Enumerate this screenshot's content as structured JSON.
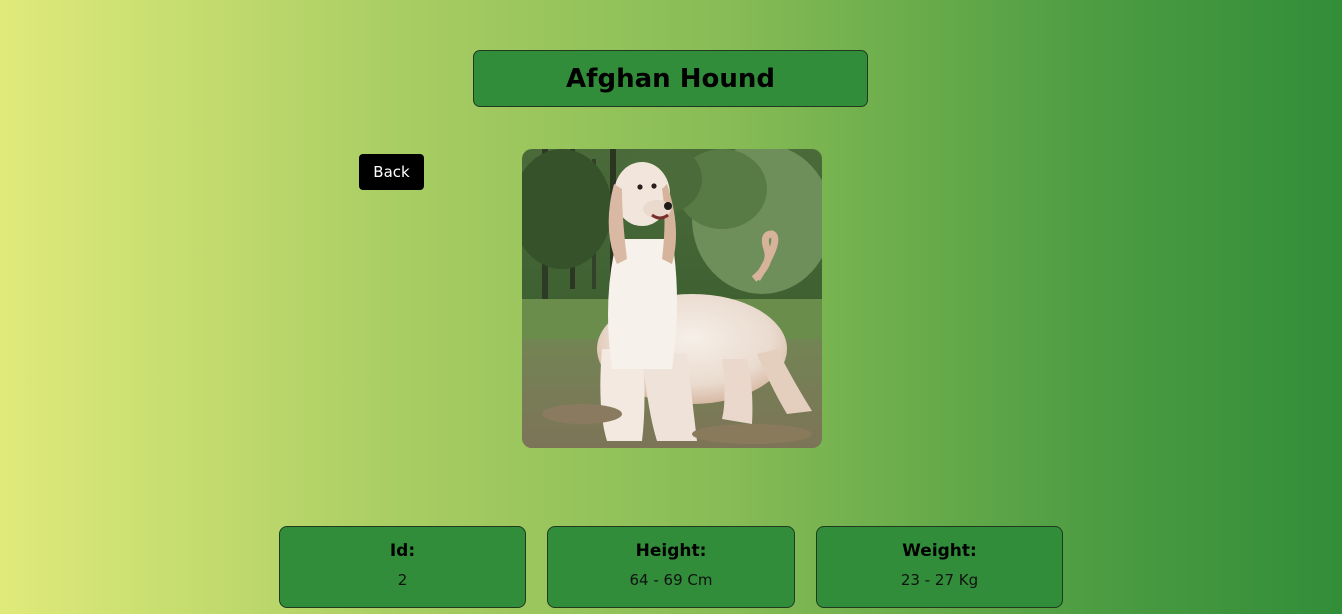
{
  "breed": {
    "name": "Afghan Hound"
  },
  "navigation": {
    "back_label": "Back"
  },
  "photo": {
    "subject": "afghan-hound-photo"
  },
  "stats": [
    {
      "label": "Id:",
      "value": "2"
    },
    {
      "label": "Height:",
      "value": "64 - 69 Cm"
    },
    {
      "label": "Weight:",
      "value": "23 - 27 Kg"
    }
  ],
  "colors": {
    "card_background": "#318d3a",
    "button_background": "#000000",
    "gradient_start": "#dfea7a",
    "gradient_end": "#328d39"
  }
}
